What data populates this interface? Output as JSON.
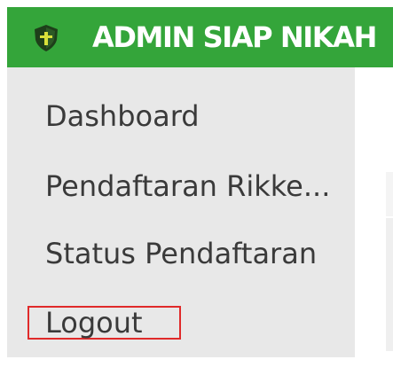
{
  "header": {
    "title": "ADMIN SIAP NIKAH",
    "logo_icon": "shield-icon"
  },
  "sidebar": {
    "items": [
      {
        "label": "Dashboard"
      },
      {
        "label": "Pendaftaran Rikke..."
      },
      {
        "label": "Status Pendaftaran"
      },
      {
        "label": "Logout"
      }
    ]
  },
  "colors": {
    "header_bg": "#34a53a",
    "sidebar_bg": "#e8e8e8",
    "highlight_border": "#e02a2a",
    "shield_dark": "#1e3f1a",
    "shield_accent": "#d8e03a"
  }
}
